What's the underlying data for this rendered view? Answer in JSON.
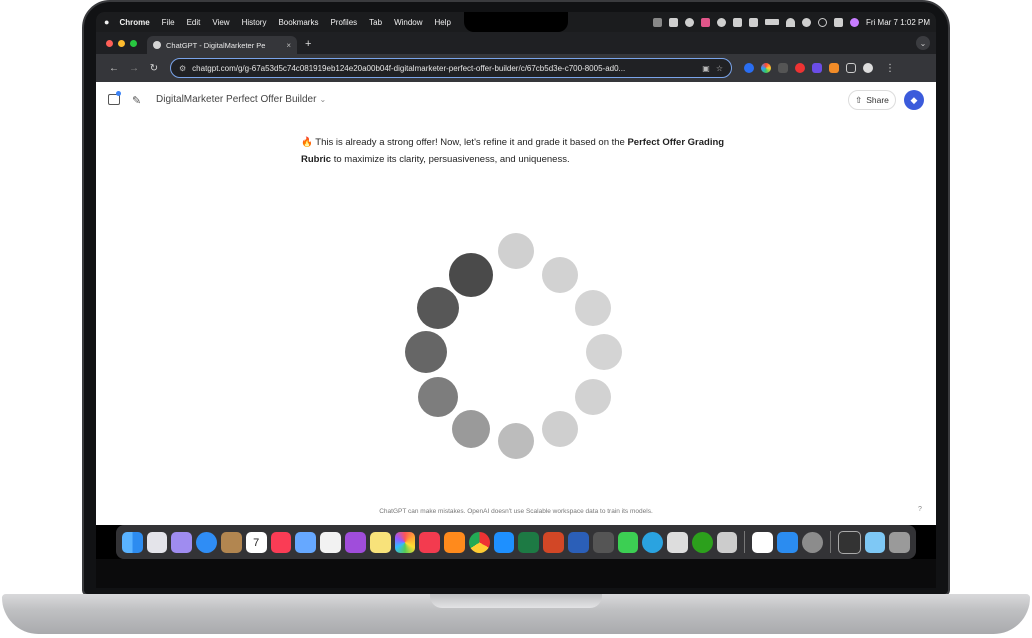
{
  "menubar": {
    "apple": "",
    "items": [
      "Chrome",
      "File",
      "Edit",
      "View",
      "History",
      "Bookmarks",
      "Profiles",
      "Tab",
      "Window",
      "Help"
    ],
    "clock": "Fri Mar 7  1:02 PM"
  },
  "browser": {
    "tab_title": "ChatGPT - DigitalMarketer Pe",
    "tab_close": "×",
    "new_tab": "+",
    "url": "chatgpt.com/g/g-67a53d5c74c081919eb124e20a00b04f-digitalmarketer-perfect-offer-builder/c/67cb5d3e-c700-8005-ad0...",
    "back": "←",
    "forward": "→",
    "reload": "↻",
    "bookmark_star": "☆",
    "menu_dots": "⋮",
    "tab_dropdown": "⌄"
  },
  "header": {
    "gpt_name": "DigitalMarketer Perfect Offer Builder",
    "chevron": "⌄",
    "share_label": "Share",
    "share_icon": "⇧",
    "compose_icon": "✎",
    "profile_icon": "◆"
  },
  "message": {
    "emoji": "🔥",
    "part1": " This is already a strong offer! Now, let's refine it and grade it based on the ",
    "bold1": "Perfect Offer Grading Rubric",
    "part2": " to maximize its clarity, persuasiveness, and uniqueness."
  },
  "footer": {
    "disclaimer": "ChatGPT can make mistakes. OpenAI doesn't use Scalable workspace data to train its models.",
    "help": "?"
  },
  "colors": {
    "accent": "#3b5bdb",
    "omnibox_border": "#7aa4ea",
    "spinner_dark": "#4a4a4a",
    "spinner_light": "#d4d4d4"
  },
  "dock_icons": [
    "finder-icon",
    "launchpad-icon",
    "apps-icon",
    "safari-icon",
    "contacts-icon",
    "calendar-icon",
    "music-icon",
    "clipboard-icon",
    "slack-icon",
    "podcasts-icon",
    "notes-icon",
    "photos-icon",
    "news-icon",
    "books-icon",
    "chrome-icon",
    "appstore-icon",
    "excel-icon",
    "powerpoint-icon",
    "word-icon",
    "calculator-icon",
    "messages-icon",
    "telegram-icon",
    "whatsapp-icon",
    "quickbooks-icon",
    "pages-icon",
    "chatgpt-icon",
    "keynote-icon",
    "system-settings-icon",
    "screenshot-icon",
    "folder-icon",
    "trash-icon"
  ],
  "calendar_day": "7"
}
